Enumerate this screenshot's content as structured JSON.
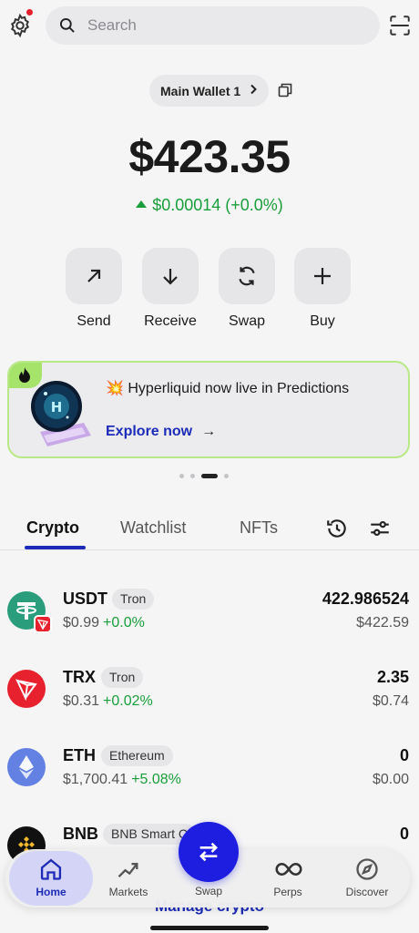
{
  "header": {
    "search_placeholder": "Search"
  },
  "wallet": {
    "name": "Main Wallet 1",
    "balance": "$423.35",
    "change": "$0.00014 (+0.0%)"
  },
  "actions": [
    {
      "label": "Send"
    },
    {
      "label": "Receive"
    },
    {
      "label": "Swap"
    },
    {
      "label": "Buy"
    }
  ],
  "banner": {
    "emoji": "💥",
    "title": "Hyperliquid now live in Predictions",
    "cta": "Explore now",
    "cta_arrow": "→"
  },
  "carousel": {
    "count": 4,
    "active_index": 2
  },
  "tabs": [
    {
      "label": "Crypto",
      "active": true
    },
    {
      "label": "Watchlist",
      "active": false
    },
    {
      "label": "NFTs",
      "active": false
    }
  ],
  "assets": [
    {
      "symbol": "USDT",
      "network": "Tron",
      "price": "$0.99",
      "change": "+0.0%",
      "amount": "422.986524",
      "value": "$422.59",
      "logo_color": "#2a9d7c"
    },
    {
      "symbol": "TRX",
      "network": "Tron",
      "price": "$0.31",
      "change": "+0.02%",
      "amount": "2.35",
      "value": "$0.74",
      "logo_color": "#e8212e"
    },
    {
      "symbol": "ETH",
      "network": "Ethereum",
      "price": "$1,700.41",
      "change": "+5.08%",
      "amount": "0",
      "value": "$0.00",
      "logo_color": "#6281e3"
    },
    {
      "symbol": "BNB",
      "network": "BNB Smart C",
      "price": "",
      "change": "",
      "amount": "0",
      "value": "",
      "logo_color": "#111111"
    }
  ],
  "manage_label": "Manage crypto",
  "nav": [
    {
      "label": "Home",
      "icon": "home-icon",
      "active": true
    },
    {
      "label": "Markets",
      "icon": "chart-icon"
    },
    {
      "label": "Swap",
      "icon": "swap-icon"
    },
    {
      "label": "Perps",
      "icon": "infinity-icon"
    },
    {
      "label": "Discover",
      "icon": "compass-icon"
    }
  ],
  "colors": {
    "accent": "#1d2cb8",
    "positive": "#1a9e3b",
    "fab": "#1d1ee0",
    "banner_border": "#b8e986"
  }
}
